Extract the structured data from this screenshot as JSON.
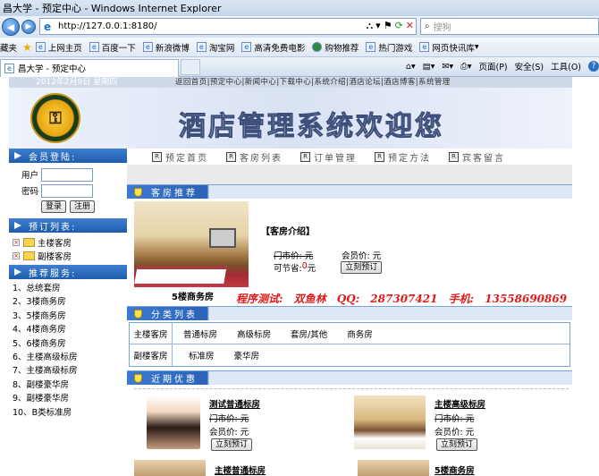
{
  "window": {
    "title": "昌大学 - 预定中心 - Windows Internet Explorer"
  },
  "address": {
    "url": "http://127.0.0.1:8180/",
    "search_placeholder": "搜狗"
  },
  "favorites": [
    {
      "label": "藏夹"
    },
    {
      "label": "上网主页"
    },
    {
      "label": "百度一下"
    },
    {
      "label": "新浪微博"
    },
    {
      "label": "淘宝网"
    },
    {
      "label": "高清免费电影"
    },
    {
      "label": "购物推荐"
    },
    {
      "label": "热门游戏"
    },
    {
      "label": "网页快讯库"
    }
  ],
  "tabs": {
    "active_label": "昌大学 - 预定中心",
    "commands": {
      "page": "页面(P)",
      "safety": "安全(S)",
      "tools": "工具(O)"
    }
  },
  "site": {
    "date": "2012年2月9日  星期四",
    "top_links": "返回首页|预定中心|新闻中心|下载中心|系统介绍|酒店论坛|酒店博客|系统管理",
    "banner_title": "酒店管理系统欢迎您",
    "logo_char": "⚿"
  },
  "sidebar": {
    "login_title": "会员登陆:",
    "user_label": "用户",
    "pwd_label": "密码",
    "login_btn": "登录",
    "register_btn": "注册",
    "booking_title": "预订列表:",
    "tree": [
      "主楼客房",
      "副楼客房"
    ],
    "recommend_title": "推荐服务:",
    "recommend": [
      "1、总统套房",
      "2、3楼商务房",
      "3、5楼商务房",
      "4、4楼商务房",
      "5、6楼商务房",
      "6、主楼高级标房",
      "7、主楼高级标房",
      "8、副楼豪华房",
      "9、副楼豪华房",
      "10、B类标准房"
    ]
  },
  "menu": [
    "预定首页",
    "客房列表",
    "订单管理",
    "预定方法",
    "宾客留言"
  ],
  "featured": {
    "header": "客房推荐",
    "intro": "【客房介绍】",
    "door_price": "门市价: 元",
    "member_price": "会员价: 元",
    "save_label": "可节省: ",
    "save_value": "0",
    "save_unit": "元",
    "book_btn": "立刻预订",
    "room_name": "5楼商务房",
    "slogan": "程序测试: 双鱼林  QQ: 287307421  手机: 13558690869"
  },
  "categories": {
    "header": "分类列表",
    "rows": [
      {
        "head": "主楼客房",
        "items": [
          "普通标房",
          "高级标房",
          "套房/其他",
          "商务房"
        ]
      },
      {
        "head": "副楼客房",
        "items": [
          "标准房",
          "豪华房"
        ]
      }
    ]
  },
  "promo": {
    "header": "近期优惠",
    "items": [
      {
        "name": "测试普通标房",
        "door": "门市价: 元",
        "member": "会员价: 元",
        "btn": "立刻预订"
      },
      {
        "name": "主楼高级标房",
        "door": "门市价: 元",
        "member": "会员价: 元",
        "btn": "立刻预订"
      },
      {
        "name": "主楼普通标房"
      },
      {
        "name": "5楼商务房"
      }
    ]
  }
}
